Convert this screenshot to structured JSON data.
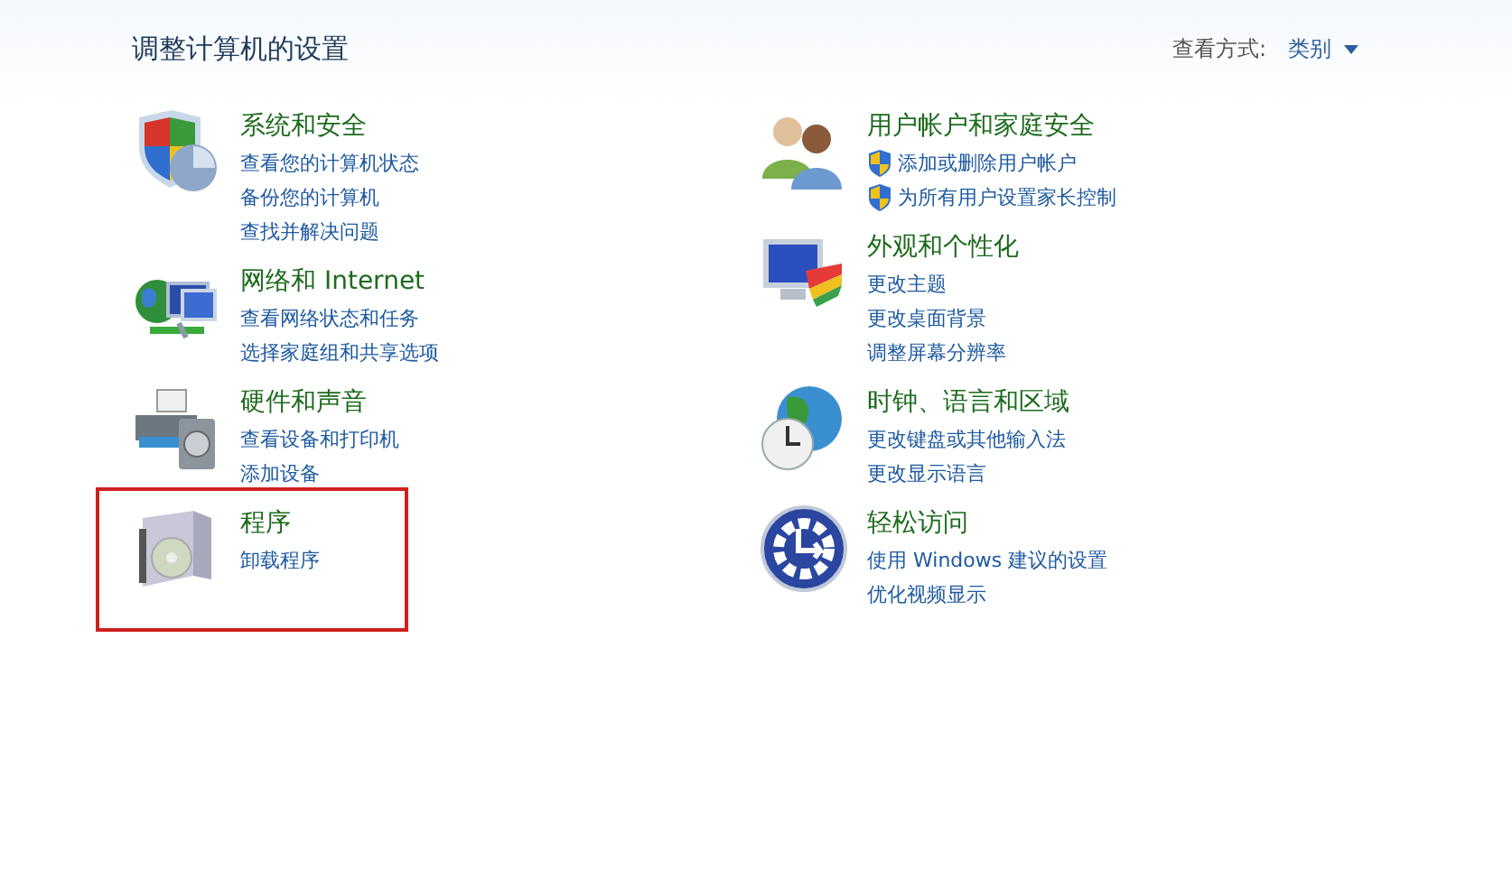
{
  "title": "调整计算机的设置",
  "view_by": {
    "label": "查看方式:",
    "value": "类别"
  },
  "columns": [
    [
      {
        "kind": "security",
        "title": "系统和安全",
        "highlighted": false,
        "links": [
          {
            "text": "查看您的计算机状态",
            "shield": false
          },
          {
            "text": "备份您的计算机",
            "shield": false
          },
          {
            "text": "查找并解决问题",
            "shield": false
          }
        ]
      },
      {
        "kind": "network",
        "title": "网络和 Internet",
        "highlighted": false,
        "links": [
          {
            "text": "查看网络状态和任务",
            "shield": false
          },
          {
            "text": "选择家庭组和共享选项",
            "shield": false
          }
        ]
      },
      {
        "kind": "hardware",
        "title": "硬件和声音",
        "highlighted": false,
        "links": [
          {
            "text": "查看设备和打印机",
            "shield": false
          },
          {
            "text": "添加设备",
            "shield": false
          }
        ]
      },
      {
        "kind": "programs",
        "title": "程序",
        "highlighted": true,
        "links": [
          {
            "text": "卸载程序",
            "shield": false
          }
        ]
      }
    ],
    [
      {
        "kind": "users",
        "title": "用户帐户和家庭安全",
        "highlighted": false,
        "links": [
          {
            "text": "添加或删除用户帐户",
            "shield": true
          },
          {
            "text": "为所有用户设置家长控制",
            "shield": true
          }
        ]
      },
      {
        "kind": "appearance",
        "title": "外观和个性化",
        "highlighted": false,
        "links": [
          {
            "text": "更改主题",
            "shield": false
          },
          {
            "text": "更改桌面背景",
            "shield": false
          },
          {
            "text": "调整屏幕分辨率",
            "shield": false
          }
        ]
      },
      {
        "kind": "clock",
        "title": "时钟、语言和区域",
        "highlighted": false,
        "links": [
          {
            "text": "更改键盘或其他输入法",
            "shield": false
          },
          {
            "text": "更改显示语言",
            "shield": false
          }
        ]
      },
      {
        "kind": "access",
        "title": "轻松访问",
        "highlighted": false,
        "links": [
          {
            "text": "使用 Windows 建议的设置",
            "shield": false
          },
          {
            "text": "优化视频显示",
            "shield": false
          }
        ]
      }
    ]
  ]
}
